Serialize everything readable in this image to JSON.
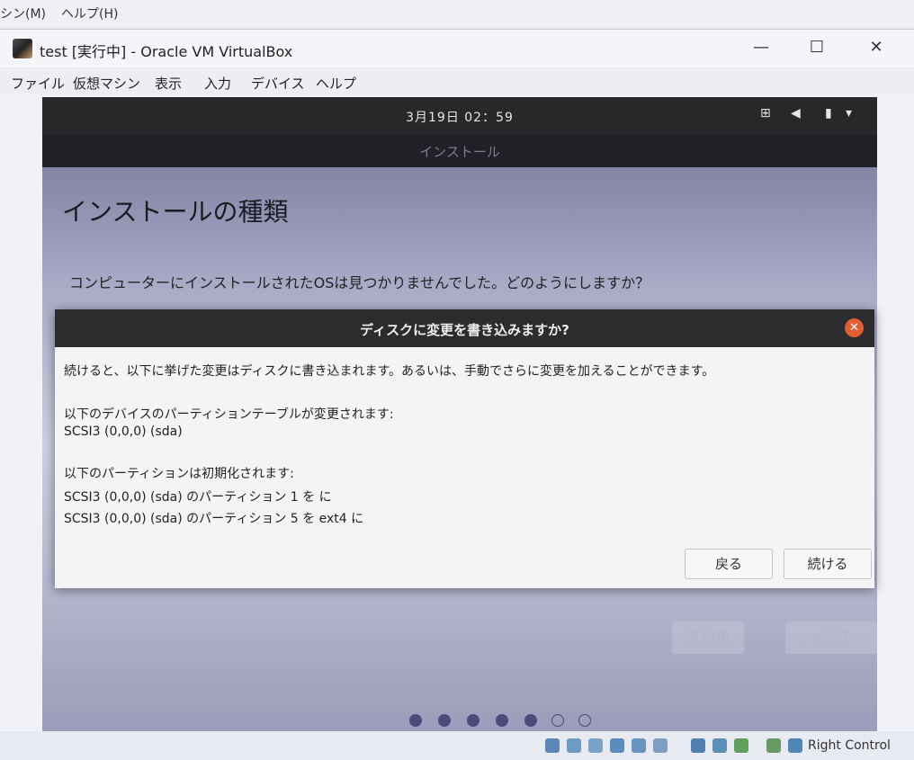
{
  "host_menu": {
    "machine": "シン(M)",
    "help": "ヘルプ(H)"
  },
  "window": {
    "title": "test [実行中] - Oracle VM VirtualBox",
    "minimize": "—",
    "maximize": "☐",
    "close": "✕"
  },
  "menubar": [
    "ファイル",
    "仮想マシン",
    "表示",
    "入力",
    "デバイス",
    "ヘルプ"
  ],
  "guest": {
    "clock": "3月19日  02：59",
    "installer_title": "インストール",
    "page_title": "インストールの種類",
    "question": "コンピューターにインストールされたOSは見つかりませんでした。どのようにしますか？",
    "back_button": "戻る(B)",
    "install_button": "インス",
    "tray": {
      "network": "⊞",
      "volume": "◀",
      "battery": "▮",
      "menu": "▾"
    }
  },
  "dialog": {
    "title": "ディスクに変更を書き込みますか?",
    "close": "✕",
    "intro": "続けると、以下に挙げた変更はディスクに書き込まれます。あるいは、手動でさらに変更を加えることができます。",
    "table_heading": "以下のデバイスのパーティションテーブルが変更されます:",
    "table_device": "SCSI3 (0,0,0) (sda)",
    "format_heading": "以下のパーティションは初期化されます:",
    "format_items": [
      "SCSI3 (0,0,0) (sda) のパーティション 1 を に",
      "SCSI3 (0,0,0) (sda) のパーティション 5 を ext4 に"
    ],
    "back_button": "戻る",
    "continue_button": "続ける"
  },
  "statusbar": {
    "host_key": "Right Control"
  },
  "colors": {
    "accent_close": "#e25e30",
    "dot_filled": "#4b4a7a"
  }
}
